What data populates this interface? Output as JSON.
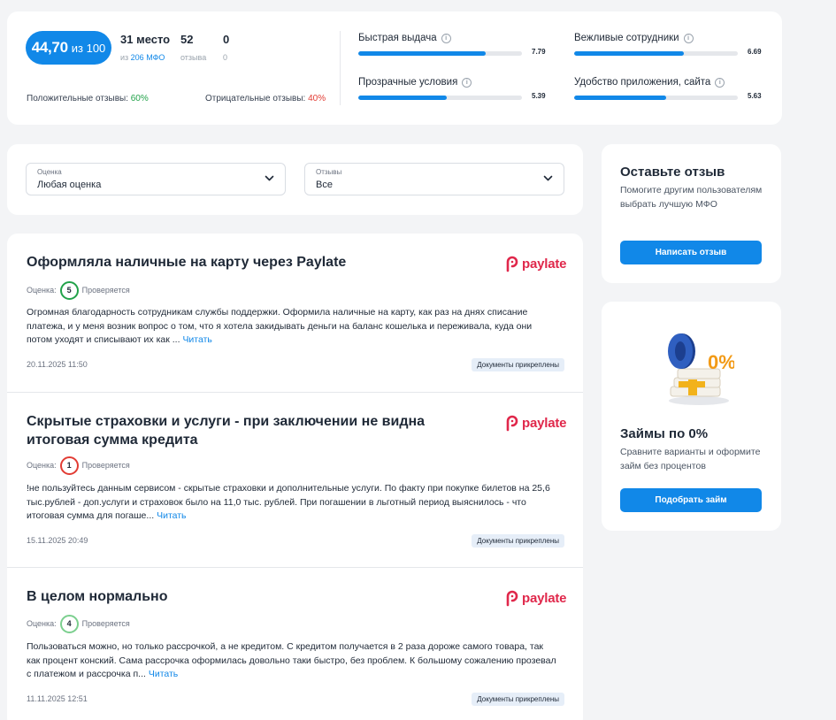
{
  "summary": {
    "score": "44,70",
    "score_of": "из 100",
    "place": "31 место",
    "place_sub_prefix": "из",
    "place_sub_link": "206 МФО",
    "reviews_count": "52",
    "reviews_label": "отзыва",
    "third_value": "0",
    "third_sub": "0",
    "positive_label": "Положительные отзывы:",
    "positive_value": "60%",
    "negative_label": "Отрицательные отзывы:",
    "negative_value": "40%",
    "criteria": [
      {
        "label": "Быстрая выдача",
        "value": "7.79",
        "fill": 0.779
      },
      {
        "label": "Вежливые сотрудники",
        "value": "6.69",
        "fill": 0.669
      },
      {
        "label": "Прозрачные условия",
        "value": "5.39",
        "fill": 0.539
      },
      {
        "label": "Удобство приложения, сайта",
        "value": "5.63",
        "fill": 0.563
      }
    ],
    "accent_color": "#1188e8"
  },
  "filters": {
    "rating": {
      "caption": "Оценка",
      "value": "Любая оценка"
    },
    "reviews": {
      "caption": "Отзывы",
      "value": "Все"
    }
  },
  "reviews": [
    {
      "title": "Оформляла наличные на карту через Paylate",
      "brand": "paylate",
      "rating_label": "Оценка:",
      "rating": "5",
      "rating_color": "#22a24a",
      "status": "Проверяется",
      "text": "Огромная благодарность сотрудникам службы поддержки. Оформила наличные на карту, как раз на днях списание платежа, и у меня возник вопрос о том, что я хотела закидывать деньги на баланс кошелька и переживала, куда они потом уходят и списывают их как ...",
      "read_more": "Читать",
      "date": "20.11.2025 11:50",
      "badge": "Документы прикреплены"
    },
    {
      "title": "Скрытые страховки и услуги - при заключении не видна итоговая сумма кредита",
      "brand": "paylate",
      "rating_label": "Оценка:",
      "rating": "1",
      "rating_color": "#e23c34",
      "status": "Проверяется",
      "text": "!не пользуйтесь данным сервисом - скрытые страховки и дополнительные услуги. По факту при покупке билетов на 25,6 тыс.рублей - доп.услуги и страховок было на 11,0 тыс. рублей. При погашении в льготный период выяснилось - что итоговая сумма для погаше...",
      "read_more": "Читать",
      "date": "15.11.2025 20:49",
      "badge": "Документы прикреплены"
    },
    {
      "title": "В целом нормально",
      "brand": "paylate",
      "rating_label": "Оценка:",
      "rating": "4",
      "rating_color": "#7bcf8e",
      "status": "Проверяется",
      "text": "Пользоваться можно, но только рассрочкой, а не кредитом. С кредитом получается в 2 раза дороже самого товара, так как процент конский. Сама рассрочка оформилась довольно таки быстро, без проблем. К большому сожалению прозевал с платежом и рассрочка п...",
      "read_more": "Читать",
      "date": "11.11.2025 12:51",
      "badge": "Документы прикреплены"
    }
  ],
  "cta": {
    "title": "Оставьте отзыв",
    "text": "Помогите другим пользователям выбрать лучшую МФО",
    "button": "Написать отзыв"
  },
  "promo": {
    "illustration_text": "0%",
    "title": "Займы по 0%",
    "text": "Сравните варианты и оформите займ без процентов",
    "button": "Подобрать займ"
  }
}
